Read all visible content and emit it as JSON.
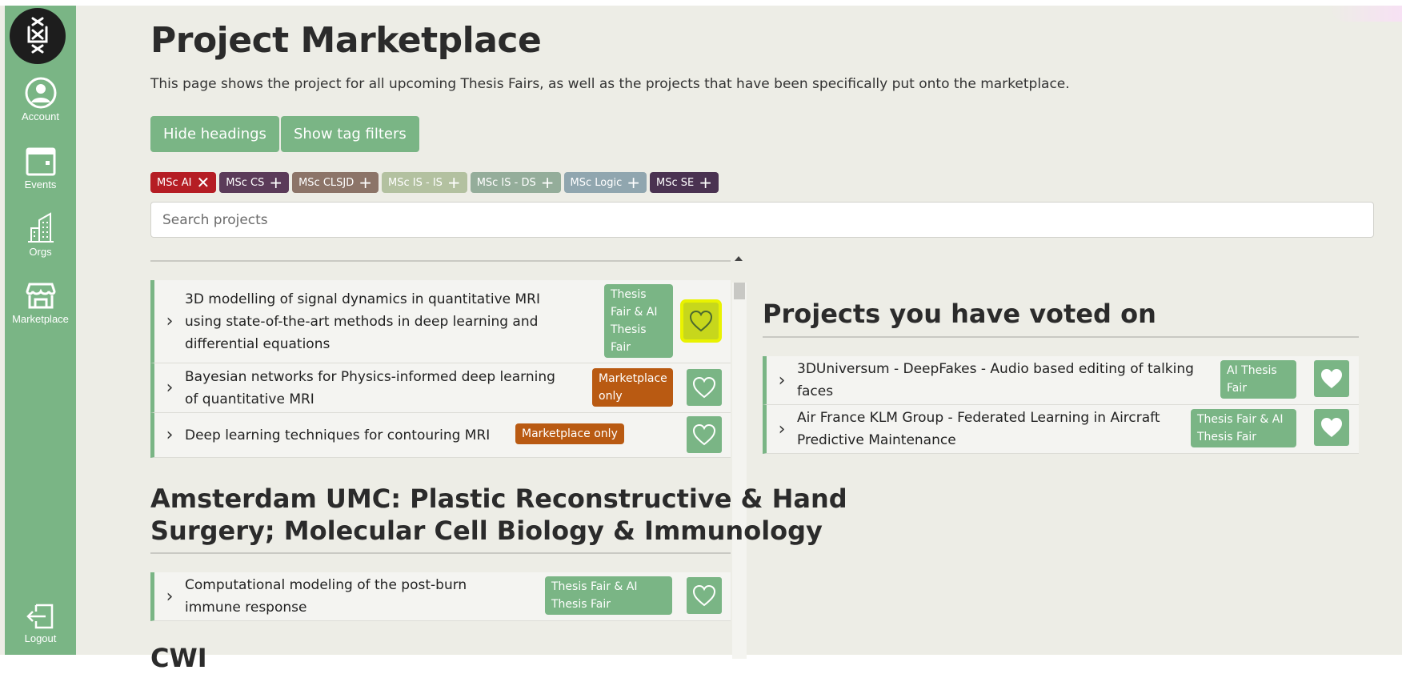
{
  "sidebar": {
    "logo_text": "UvA",
    "items": [
      {
        "label": "Account",
        "icon": "account-icon"
      },
      {
        "label": "Events",
        "icon": "calendar-icon"
      },
      {
        "label": "Orgs",
        "icon": "building-icon"
      },
      {
        "label": "Marketplace",
        "icon": "storefront-icon"
      },
      {
        "label": "Logout",
        "icon": "logout-icon"
      }
    ]
  },
  "header": {
    "title": "Project Marketplace",
    "description": "This page shows the project for all upcoming Thesis Fairs, as well as the projects that have been specifically put onto the marketplace."
  },
  "buttons": {
    "hide_headings": "Hide headings",
    "show_tag_filters": "Show tag filters"
  },
  "tags": [
    {
      "label": "MSc AI",
      "symbol": "✕",
      "color": "#b51d24",
      "selected": true
    },
    {
      "label": "MSc CS",
      "symbol": "+",
      "color": "#5b3b59",
      "selected": false
    },
    {
      "label": "MSc CLSJD",
      "symbol": "+",
      "color": "#8c7468",
      "selected": false
    },
    {
      "label": "MSc IS - IS",
      "symbol": "+",
      "color": "#b3c1a0",
      "selected": false
    },
    {
      "label": "MSc IS - DS",
      "symbol": "+",
      "color": "#94ad9a",
      "selected": false
    },
    {
      "label": "MSc Logic",
      "symbol": "+",
      "color": "#90a6af",
      "selected": false
    },
    {
      "label": "MSc SE",
      "symbol": "+",
      "color": "#4a3251",
      "selected": false
    }
  ],
  "search": {
    "placeholder": "Search projects",
    "value": ""
  },
  "groups": [
    {
      "heading": "",
      "projects": [
        {
          "title_lines": [
            "3D modelling of signal dynamics in quantitative MRI",
            "using state-of-the-art methods in deep learning and",
            "differential equations"
          ],
          "badge_lines": [
            "Thesis",
            "Fair & AI",
            "Thesis",
            "Fair"
          ],
          "badge_color": "#7ab585",
          "voted": false,
          "highlighted": true
        },
        {
          "title_lines": [
            "Bayesian networks for Physics-informed deep learning",
            "of quantitative MRI"
          ],
          "badge_lines": [
            "Marketplace",
            "only"
          ],
          "badge_color": "#b95a12",
          "voted": false
        },
        {
          "title_lines": [
            "Deep learning techniques for contouring MRI"
          ],
          "badge_lines": [
            "Marketplace only"
          ],
          "badge_color": "#b95a12",
          "voted": false
        }
      ]
    },
    {
      "heading_lines": [
        "Amsterdam UMC: Plastic Reconstructive & Hand",
        "Surgery; Molecular Cell Biology & Immunology"
      ],
      "projects": [
        {
          "title_lines": [
            "Computational modeling of the post-burn",
            "immune response"
          ],
          "badge_lines": [
            "Thesis Fair & AI",
            "Thesis Fair"
          ],
          "badge_color": "#7ab585",
          "voted": false
        }
      ]
    },
    {
      "heading_lines": [
        "CWI"
      ],
      "projects": []
    }
  ],
  "voted": {
    "title": "Projects you have voted on",
    "projects": [
      {
        "title_lines": [
          "3DUniversum - DeepFakes - Audio based editing of talking",
          "faces"
        ],
        "badge_lines": [
          "AI Thesis",
          "Fair"
        ],
        "voted": true
      },
      {
        "title_lines": [
          "Air France KLM Group - Federated Learning in Aircraft",
          "Predictive Maintenance"
        ],
        "badge_lines": [
          "Thesis Fair & AI",
          "Thesis Fair"
        ],
        "voted": true
      }
    ]
  },
  "colors": {
    "accent": "#7ab585",
    "orange": "#b95a12",
    "highlight": "#e9f200",
    "background": "#edede6"
  }
}
